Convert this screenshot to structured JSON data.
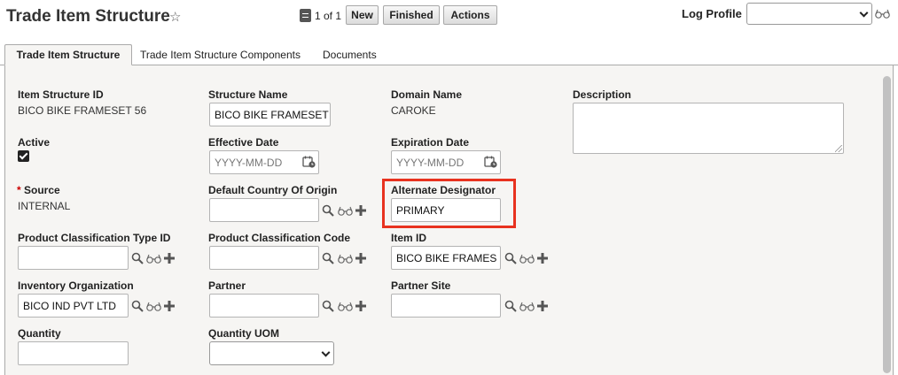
{
  "header": {
    "title": "Trade Item Structure",
    "record_count": "1 of 1",
    "buttons": {
      "new": "New",
      "finished": "Finished",
      "actions": "Actions"
    },
    "log_profile_label": "Log Profile",
    "log_profile_value": ""
  },
  "tabs": [
    {
      "label": "Trade Item Structure",
      "active": true
    },
    {
      "label": "Trade Item Structure Components",
      "active": false
    },
    {
      "label": "Documents",
      "active": false
    }
  ],
  "form": {
    "item_structure_id": {
      "label": "Item Structure ID",
      "value": "BICO BIKE FRAMESET 56"
    },
    "structure_name": {
      "label": "Structure Name",
      "value": "BICO BIKE FRAMESET"
    },
    "domain_name": {
      "label": "Domain Name",
      "value": "CAROKE"
    },
    "description": {
      "label": "Description",
      "value": ""
    },
    "active": {
      "label": "Active",
      "checked": true
    },
    "effective_date": {
      "label": "Effective Date",
      "placeholder": "YYYY-MM-DD"
    },
    "expiration_date": {
      "label": "Expiration Date",
      "placeholder": "YYYY-MM-DD"
    },
    "source": {
      "required_mark": "*",
      "label": "Source",
      "value": "INTERNAL"
    },
    "default_country_of_origin": {
      "label": "Default Country Of Origin",
      "value": ""
    },
    "alternate_designator": {
      "label": "Alternate Designator",
      "value": "PRIMARY"
    },
    "product_classification_type_id": {
      "label": "Product Classification Type ID",
      "value": ""
    },
    "product_classification_code": {
      "label": "Product Classification Code",
      "value": ""
    },
    "item_id": {
      "label": "Item ID",
      "value": "BICO BIKE FRAMES"
    },
    "inventory_organization": {
      "label": "Inventory Organization",
      "value": "BICO IND PVT LTD"
    },
    "partner": {
      "label": "Partner",
      "value": ""
    },
    "partner_site": {
      "label": "Partner Site",
      "value": ""
    },
    "quantity": {
      "label": "Quantity",
      "value": ""
    },
    "quantity_uom": {
      "label": "Quantity UOM",
      "value": ""
    }
  },
  "colors": {
    "highlight": "#e8321f",
    "panel_bg": "#f6f5f3"
  },
  "icons": [
    "star-icon",
    "record-list-icon",
    "glasses-icon",
    "calendar-icon",
    "search-icon",
    "plus-icon",
    "chevron-down-icon"
  ]
}
